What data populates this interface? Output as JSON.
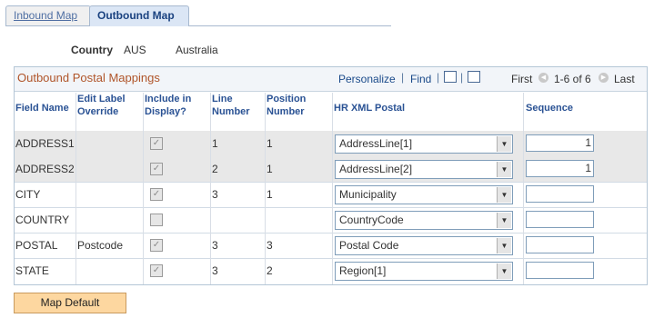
{
  "tabs": [
    {
      "label": "Inbound Map"
    },
    {
      "label": "Outbound Map"
    }
  ],
  "country": {
    "label": "Country",
    "code": "AUS",
    "name": "Australia"
  },
  "grid": {
    "title": "Outbound Postal Mappings",
    "personalize": "Personalize",
    "find": "Find",
    "first": "First",
    "range": "1-6 of 6",
    "last": "Last",
    "columns": [
      "Field Name",
      "Edit Label Override",
      "Include in Display?",
      "Line Number",
      "Position Number",
      "HR XML Postal",
      "Sequence"
    ],
    "rows": [
      {
        "field": "ADDRESS1",
        "override": "",
        "include": "checked",
        "line": "1",
        "position": "1",
        "postal": "AddressLine[1]",
        "sequence": "1"
      },
      {
        "field": "ADDRESS2",
        "override": "",
        "include": "checked",
        "line": "2",
        "position": "1",
        "postal": "AddressLine[2]",
        "sequence": "1"
      },
      {
        "field": "CITY",
        "override": "",
        "include": "checked",
        "line": "3",
        "position": "1",
        "postal": "Municipality",
        "sequence": ""
      },
      {
        "field": "COUNTRY",
        "override": "",
        "include": "unchecked",
        "line": "",
        "position": "",
        "postal": "CountryCode",
        "sequence": ""
      },
      {
        "field": "POSTAL",
        "override": "Postcode",
        "include": "checked",
        "line": "3",
        "position": "3",
        "postal": "Postal Code",
        "sequence": ""
      },
      {
        "field": "STATE",
        "override": "",
        "include": "checked",
        "line": "3",
        "position": "2",
        "postal": "Region[1]",
        "sequence": ""
      }
    ]
  },
  "map_default_label": "Map Default"
}
